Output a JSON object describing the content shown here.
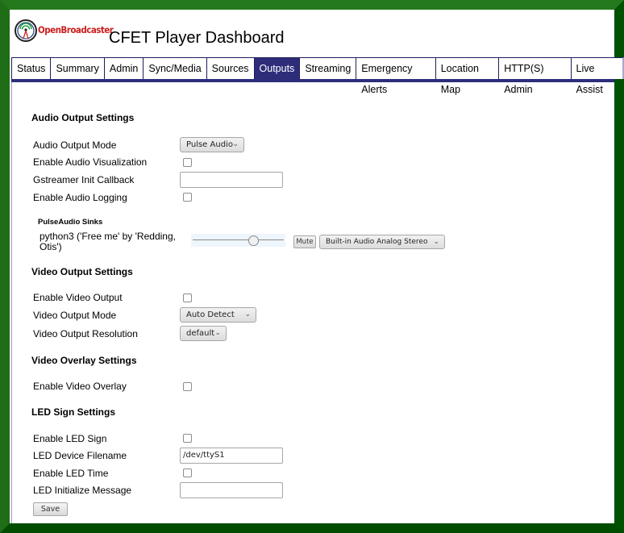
{
  "header": {
    "brand": "OpenBroadcaster",
    "title": "CFET Player Dashboard",
    "logo_icon": "radio-tower-icon"
  },
  "tabs": [
    {
      "label": "Status",
      "active": false
    },
    {
      "label": "Summary",
      "active": false
    },
    {
      "label": "Admin",
      "active": false
    },
    {
      "label": "Sync/Media",
      "active": false
    },
    {
      "label": "Sources",
      "active": false
    },
    {
      "label": "Outputs",
      "active": true
    },
    {
      "label": "Streaming",
      "active": false
    },
    {
      "label": "Emergency Alerts",
      "active": false
    },
    {
      "label": "Location Map",
      "active": false
    },
    {
      "label": "HTTP(S) Admin",
      "active": false
    },
    {
      "label": "Live Assist",
      "active": false
    }
  ],
  "audio": {
    "heading": "Audio Output Settings",
    "output_mode_label": "Audio Output Mode",
    "output_mode_value": "Pulse Audio",
    "visualization_label": "Enable Audio Visualization",
    "visualization_checked": false,
    "gst_callback_label": "Gstreamer Init Callback",
    "gst_callback_value": "",
    "logging_label": "Enable Audio Logging",
    "logging_checked": false,
    "sinks_heading": "PulseAudio Sinks",
    "sink": {
      "name_line1": "python3 ('Free me' by 'Redding,",
      "name_line2": "Otis')",
      "volume_fraction": 0.67,
      "mute_label": "Mute",
      "device_value": "Built-in Audio Analog Stereo"
    }
  },
  "video": {
    "heading": "Video Output Settings",
    "enable_label": "Enable Video Output",
    "enable_checked": false,
    "mode_label": "Video Output Mode",
    "mode_value": "Auto Detect",
    "resolution_label": "Video Output Resolution",
    "resolution_value": "default"
  },
  "overlay": {
    "heading": "Video Overlay Settings",
    "enable_label": "Enable Video Overlay",
    "enable_checked": false
  },
  "led": {
    "heading": "LED Sign Settings",
    "enable_label": "Enable LED Sign",
    "enable_checked": false,
    "device_label": "LED Device Filename",
    "device_value": "/dev/ttyS1",
    "time_label": "Enable LED Time",
    "time_checked": false,
    "init_msg_label": "LED Initialize Message",
    "init_msg_value": ""
  },
  "save_label": "Save",
  "colors": {
    "frame_green": "#24791d",
    "frame_dark_green": "#004d00",
    "tab_active": "#2d2d7a",
    "brand_red": "#cc1f1f"
  }
}
